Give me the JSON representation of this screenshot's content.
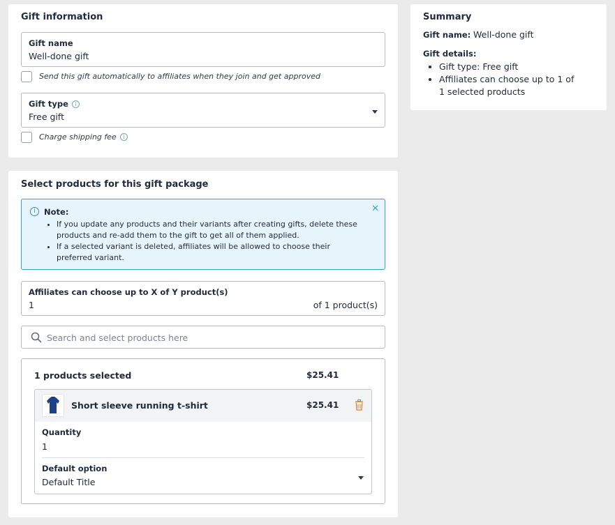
{
  "gift_info": {
    "title": "Gift information",
    "gift_name_label": "Gift name",
    "gift_name_value": "Well-done gift",
    "auto_send_label": "Send this gift automatically to affiliates when they join and get approved",
    "gift_type_label": "Gift type",
    "gift_type_value": "Free gift",
    "charge_shipping_label": "Charge shipping fee"
  },
  "summary": {
    "title": "Summary",
    "gift_name_label": "Gift name:",
    "gift_name_value": "Well-done gift",
    "gift_details_label": "Gift details:",
    "details": [
      "Gift type: Free gift",
      "Affiliates can choose up to 1 of 1 selected products"
    ]
  },
  "products": {
    "title": "Select products for this gift package",
    "note_title": "Note:",
    "note_items": [
      "If you update any products and their variants after creating gifts, delete these products and re-add them to the gift to get all of them applied.",
      "If a selected variant is deleted, affiliates will be allowed to choose their preferred variant."
    ],
    "choose_label": "Affiliates can choose up to X of Y product(s)",
    "choose_value": "1",
    "choose_suffix": "of 1 product(s)",
    "search_placeholder": "Search and select products here",
    "selected_count_label": "1 products selected",
    "selected_total": "$25.41",
    "item": {
      "name": "Short sleeve running t-shirt",
      "price": "$25.41",
      "quantity_label": "Quantity",
      "quantity_value": "1",
      "default_option_label": "Default option",
      "default_option_value": "Default Title"
    }
  },
  "colors": {
    "page_bg": "#ebebeb",
    "note_bg": "#e6f5fb",
    "note_border": "#3ea0c9",
    "delete_icon": "#d9822b",
    "shirt": "#1e3f8a"
  },
  "icons": [
    "info-icon",
    "chevron-down-icon",
    "close-icon",
    "search-icon",
    "trash-icon",
    "tshirt-icon"
  ]
}
